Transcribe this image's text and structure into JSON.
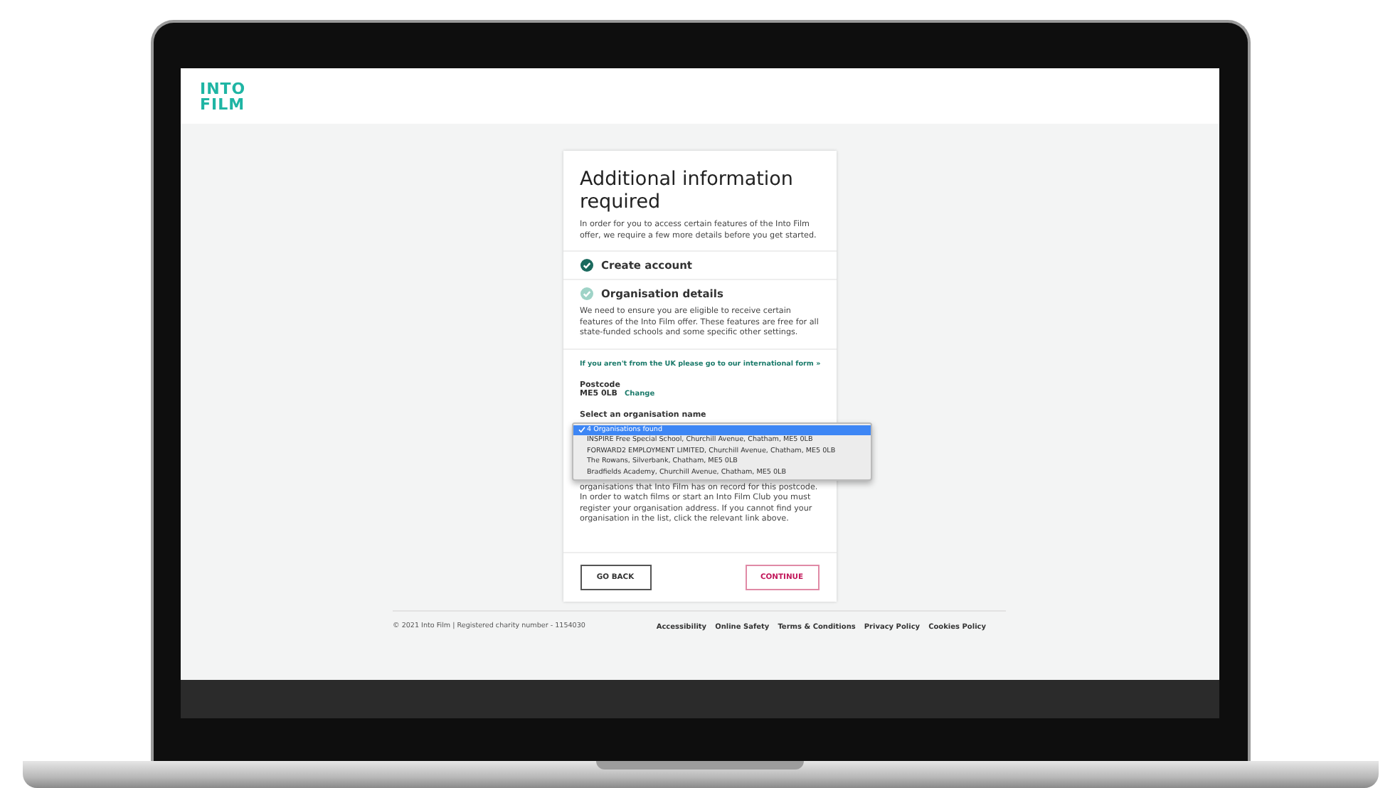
{
  "logo": {
    "lines": [
      "INTO",
      "FILM"
    ]
  },
  "card": {
    "title": "Additional information required",
    "intro": "In order for you to access certain features of the Into Film offer, we require a few more details before you get started.",
    "steps": [
      {
        "label": "Create account",
        "completed": true
      },
      {
        "label": "Organisation details",
        "completed": false
      }
    ],
    "step_text": "We need to ensure you are eligible to receive certain features of the Into Film offer. These features are free for all state-funded schools and some specific other settings.",
    "international_link": "If you aren't from the UK please go to our international form »",
    "postcode": {
      "label": "Postcode",
      "value": "ME5 0LB",
      "change": "Change"
    },
    "select_label": "Select an organisation name",
    "options": [
      {
        "text": "4 Organisations found",
        "selected": true
      },
      {
        "text": "INSPIRE Free Special School, Churchill Avenue, Chatham, ME5 0LB",
        "selected": false
      },
      {
        "text": "FORWARD2 EMPLOYMENT LIMITED, Churchill Avenue, Chatham, ME5 0LB",
        "selected": false
      },
      {
        "text": "The Rowans, Silverbank, Chatham, ME5 0LB",
        "selected": false
      },
      {
        "text": "Bradfields Academy, Churchill Avenue, Chatham, ME5 0LB",
        "selected": false
      }
    ],
    "help_text": "organisations that Into Film has on record for this postcode. In order to watch films or start an Into Film Club you must register your organisation address. If you cannot find your organisation in the list, click the relevant link above.",
    "buttons": {
      "back": "GO BACK",
      "continue": "CONTINUE"
    }
  },
  "footer": {
    "copyright": "© 2021 Into Film | Registered charity number - 1154030",
    "links": [
      "Accessibility",
      "Online Safety",
      "Terms & Conditions",
      "Privacy Policy",
      "Cookies Policy"
    ]
  }
}
